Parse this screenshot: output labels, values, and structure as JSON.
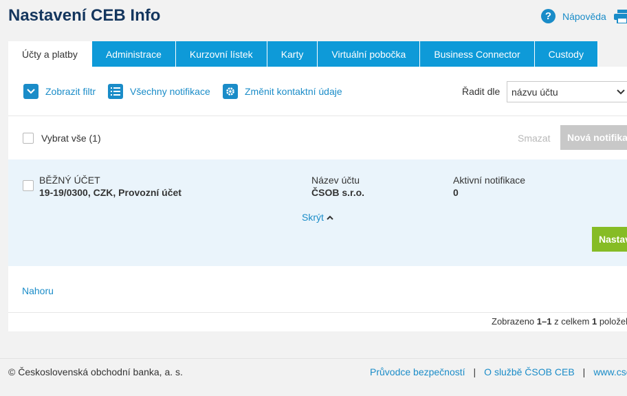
{
  "header": {
    "title": "Nastavení CEB Info",
    "help_label": "Nápověda"
  },
  "tabs": [
    {
      "label": "Účty a platby",
      "active": true
    },
    {
      "label": "Administrace"
    },
    {
      "label": "Kurzovní lístek"
    },
    {
      "label": "Karty"
    },
    {
      "label": "Virtuální pobočka"
    },
    {
      "label": "Business Connector"
    },
    {
      "label": "Custody"
    }
  ],
  "toolbar": {
    "show_filter": "Zobrazit filtr",
    "all_notifications": "Všechny notifikace",
    "change_contact": "Změnit kontaktní údaje",
    "sort_label": "Řadit dle",
    "sort_value": "názvu účtu"
  },
  "selection": {
    "select_all": "Vybrat vše (1)",
    "delete": "Smazat",
    "new_notification": "Nová notifikace"
  },
  "account": {
    "type": "BĚŽNÝ ÚČET",
    "number": "19-19/0300, CZK, Provozní účet",
    "name_label": "Název účtu",
    "name_value": "ČSOB s.r.o.",
    "active_label": "Aktivní notifikace",
    "active_value": "0",
    "hide": "Skrýt",
    "settings_button": "Nastavit"
  },
  "top_link": "Nahoru",
  "pagination": {
    "prefix": "Zobrazeno ",
    "range": "1–1",
    "middle": " z celkem ",
    "total": "1",
    "suffix": " položek"
  },
  "footer": {
    "copyright": "© Československá obchodní banka, a. s.",
    "links": [
      "Průvodce bezpečností",
      "O službě ČSOB CEB",
      "www.csob.cz"
    ],
    "separator": "|"
  },
  "colors": {
    "brand_dark": "#14365e",
    "accent": "#0e9ad8",
    "link": "#1a8cc8",
    "primary_button": "#86bc25",
    "row_highlight": "#eaf4fb"
  }
}
